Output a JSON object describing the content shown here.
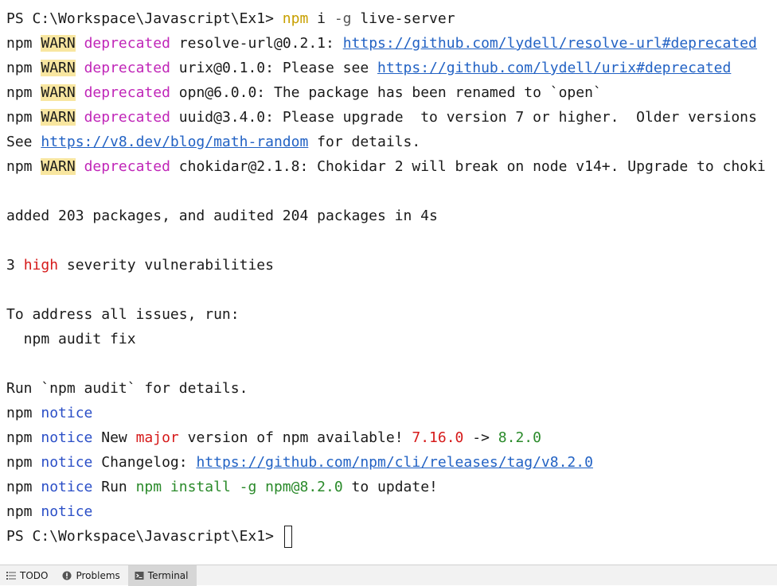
{
  "terminal": {
    "lines": [
      {
        "segments": [
          {
            "text": "PS C:\\Workspace\\Javascript\\Ex1> ",
            "style": "plain"
          },
          {
            "text": "npm",
            "style": "yellow"
          },
          {
            "text": " i ",
            "style": "plain"
          },
          {
            "text": "-g",
            "style": "gray"
          },
          {
            "text": " live-server",
            "style": "plain"
          }
        ]
      },
      {
        "segments": [
          {
            "text": "npm ",
            "style": "plain"
          },
          {
            "text": "WARN",
            "style": "warn"
          },
          {
            "text": " ",
            "style": "plain"
          },
          {
            "text": "deprecated",
            "style": "magenta"
          },
          {
            "text": " resolve-url@0.2.1: ",
            "style": "plain"
          },
          {
            "text": "https://github.com/lydell/resolve-url#deprecated",
            "style": "link"
          }
        ]
      },
      {
        "segments": [
          {
            "text": "npm ",
            "style": "plain"
          },
          {
            "text": "WARN",
            "style": "warn"
          },
          {
            "text": " ",
            "style": "plain"
          },
          {
            "text": "deprecated",
            "style": "magenta"
          },
          {
            "text": " urix@0.1.0: Please see ",
            "style": "plain"
          },
          {
            "text": "https://github.com/lydell/urix#deprecated",
            "style": "link"
          }
        ]
      },
      {
        "segments": [
          {
            "text": "npm ",
            "style": "plain"
          },
          {
            "text": "WARN",
            "style": "warn"
          },
          {
            "text": " ",
            "style": "plain"
          },
          {
            "text": "deprecated",
            "style": "magenta"
          },
          {
            "text": " opn@6.0.0: The package has been renamed to `open`",
            "style": "plain"
          }
        ]
      },
      {
        "segments": [
          {
            "text": "npm ",
            "style": "plain"
          },
          {
            "text": "WARN",
            "style": "warn"
          },
          {
            "text": " ",
            "style": "plain"
          },
          {
            "text": "deprecated",
            "style": "magenta"
          },
          {
            "text": " uuid@3.4.0: Please upgrade  to version 7 or higher.  Older versions",
            "style": "plain"
          }
        ]
      },
      {
        "segments": [
          {
            "text": "See ",
            "style": "plain"
          },
          {
            "text": "https://v8.dev/blog/math-random",
            "style": "link"
          },
          {
            "text": " for details.",
            "style": "plain"
          }
        ]
      },
      {
        "segments": [
          {
            "text": "npm ",
            "style": "plain"
          },
          {
            "text": "WARN",
            "style": "warn"
          },
          {
            "text": " ",
            "style": "plain"
          },
          {
            "text": "deprecated",
            "style": "magenta"
          },
          {
            "text": " chokidar@2.1.8: Chokidar 2 will break on node v14+. Upgrade to choki",
            "style": "plain"
          }
        ]
      },
      {
        "segments": []
      },
      {
        "segments": [
          {
            "text": "added 203 packages, and audited 204 packages in 4s",
            "style": "plain"
          }
        ]
      },
      {
        "segments": []
      },
      {
        "segments": [
          {
            "text": "3 ",
            "style": "plain"
          },
          {
            "text": "high",
            "style": "red"
          },
          {
            "text": " severity vulnerabilities",
            "style": "plain"
          }
        ]
      },
      {
        "segments": []
      },
      {
        "segments": [
          {
            "text": "To address all issues, run:",
            "style": "plain"
          }
        ]
      },
      {
        "segments": [
          {
            "text": "  npm audit fix",
            "style": "plain"
          }
        ]
      },
      {
        "segments": []
      },
      {
        "segments": [
          {
            "text": "Run `npm audit` for details.",
            "style": "plain"
          }
        ]
      },
      {
        "segments": [
          {
            "text": "npm ",
            "style": "plain"
          },
          {
            "text": "notice",
            "style": "blue"
          }
        ]
      },
      {
        "segments": [
          {
            "text": "npm ",
            "style": "plain"
          },
          {
            "text": "notice",
            "style": "blue"
          },
          {
            "text": " New ",
            "style": "plain"
          },
          {
            "text": "major",
            "style": "red"
          },
          {
            "text": " version of npm available! ",
            "style": "plain"
          },
          {
            "text": "7.16.0",
            "style": "red"
          },
          {
            "text": " -> ",
            "style": "plain"
          },
          {
            "text": "8.2.0",
            "style": "green"
          }
        ]
      },
      {
        "segments": [
          {
            "text": "npm ",
            "style": "plain"
          },
          {
            "text": "notice",
            "style": "blue"
          },
          {
            "text": " Changelog: ",
            "style": "plain"
          },
          {
            "text": "https://github.com/npm/cli/releases/tag/v8.2.0",
            "style": "link"
          }
        ]
      },
      {
        "segments": [
          {
            "text": "npm ",
            "style": "plain"
          },
          {
            "text": "notice",
            "style": "blue"
          },
          {
            "text": " Run ",
            "style": "plain"
          },
          {
            "text": "npm install -g npm@8.2.0",
            "style": "green"
          },
          {
            "text": " to update!",
            "style": "plain"
          }
        ]
      },
      {
        "segments": [
          {
            "text": "npm ",
            "style": "plain"
          },
          {
            "text": "notice",
            "style": "blue"
          }
        ]
      },
      {
        "segments": [
          {
            "text": "PS C:\\Workspace\\Javascript\\Ex1> ",
            "style": "plain"
          }
        ],
        "cursor": true
      }
    ]
  },
  "toolbar": {
    "tabs": [
      {
        "label": "TODO",
        "icon": "list-icon",
        "active": false
      },
      {
        "label": "Problems",
        "icon": "warning-circle-icon",
        "active": false
      },
      {
        "label": "Terminal",
        "icon": "terminal-icon",
        "active": true
      }
    ]
  },
  "colors": {
    "background": "#ffffff",
    "text": "#1a1a1a",
    "warn_bg": "#f8e6a0",
    "deprecated": "#c026b8",
    "link": "#2262c4",
    "notice": "#2b4fc7",
    "red": "#d61a1a",
    "green": "#2a8a2a",
    "command": "#c8a000",
    "toolbar_bg": "#f2f2f2",
    "active_tab_bg": "#d6d6d6"
  }
}
